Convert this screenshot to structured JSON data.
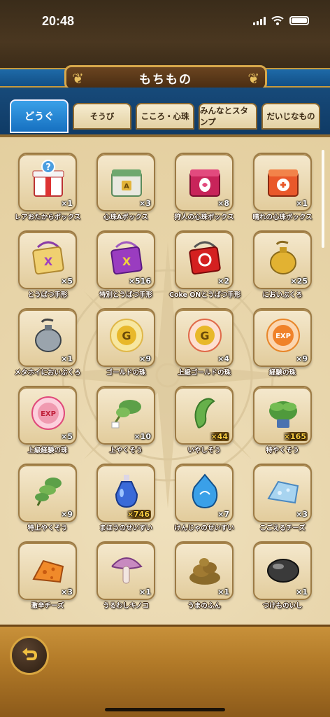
{
  "status": {
    "time": "20:48"
  },
  "header": {
    "title": "もちもの"
  },
  "tabs": [
    {
      "label": "どうぐ",
      "active": true
    },
    {
      "label": "そうび",
      "active": false
    },
    {
      "label": "こころ・心珠",
      "active": false
    },
    {
      "label": "みんなとスタンプ",
      "active": false
    },
    {
      "label": "だいじなもの",
      "active": false
    }
  ],
  "items": [
    {
      "name": "レアおたからボックス",
      "count": "×1",
      "icon": "gift-box-icon",
      "highlight": false
    },
    {
      "name": "心珠Aボックス",
      "count": "×3",
      "icon": "heart-gem-box-a-icon",
      "highlight": false
    },
    {
      "name": "狩人の心珠ボックス",
      "count": "×8",
      "icon": "hunter-heart-gem-box-icon",
      "highlight": false
    },
    {
      "name": "晴れの心珠ボックス",
      "count": "×1",
      "icon": "sunny-heart-gem-box-icon",
      "highlight": false
    },
    {
      "name": "とうばつ手形",
      "count": "×5",
      "icon": "subjugation-pass-icon",
      "highlight": false
    },
    {
      "name": "特別とうばつ手形",
      "count": "×516",
      "icon": "special-subjugation-pass-icon",
      "highlight": false
    },
    {
      "name": "Coke ONとうばつ手形",
      "count": "×2",
      "icon": "coke-on-pass-icon",
      "highlight": false
    },
    {
      "name": "においぶくろ",
      "count": "×25",
      "icon": "scent-bag-icon",
      "highlight": false
    },
    {
      "name": "メタホイにおいぶくろ",
      "count": "×1",
      "icon": "metal-scent-bag-icon",
      "highlight": false
    },
    {
      "name": "ゴールドの珠",
      "count": "×9",
      "icon": "gold-orb-icon",
      "highlight": false
    },
    {
      "name": "上級ゴールドの珠",
      "count": "×4",
      "icon": "advanced-gold-orb-icon",
      "highlight": false
    },
    {
      "name": "経験の珠",
      "count": "×9",
      "icon": "exp-orb-icon",
      "highlight": false
    },
    {
      "name": "上級経験の珠",
      "count": "×5",
      "icon": "advanced-exp-orb-icon",
      "highlight": false
    },
    {
      "name": "上やくそう",
      "count": "×10",
      "icon": "high-herb-icon",
      "highlight": false
    },
    {
      "name": "いやしそう",
      "count": "×44",
      "icon": "healing-herb-icon",
      "highlight": true
    },
    {
      "name": "特やくそう",
      "count": "×165",
      "icon": "special-herb-icon",
      "highlight": true
    },
    {
      "name": "特上やくそう",
      "count": "×9",
      "icon": "premium-herb-icon",
      "highlight": false
    },
    {
      "name": "まほうのせいすい",
      "count": "×746",
      "icon": "magic-water-icon",
      "highlight": true
    },
    {
      "name": "けんじゃのせいすい",
      "count": "×7",
      "icon": "sage-water-icon",
      "highlight": false
    },
    {
      "name": "こごえるチーズ",
      "count": "×3",
      "icon": "frozen-cheese-icon",
      "highlight": false
    },
    {
      "name": "激辛チーズ",
      "count": "×3",
      "icon": "spicy-cheese-icon",
      "highlight": false
    },
    {
      "name": "うるわしキノコ",
      "count": "×1",
      "icon": "mushroom-icon",
      "highlight": false
    },
    {
      "name": "うまのふん",
      "count": "×1",
      "icon": "horse-dung-icon",
      "highlight": false
    },
    {
      "name": "つけものいし",
      "count": "×1",
      "icon": "pickle-stone-icon",
      "highlight": false
    }
  ],
  "colors": {
    "accent_blue": "#1670c0",
    "gold_border": "#d7a84b",
    "parchment": "#e9d7ae",
    "highlight_count": "#ffcf40"
  }
}
